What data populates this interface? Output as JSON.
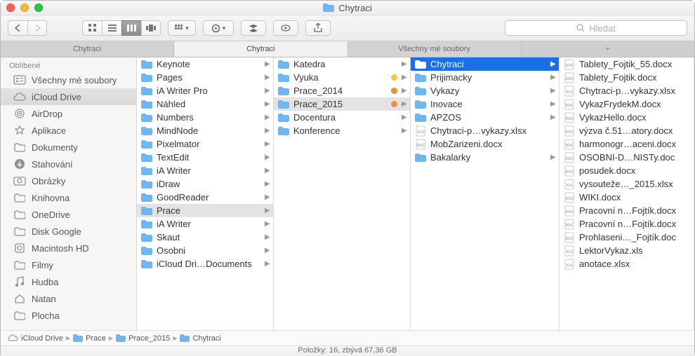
{
  "window": {
    "title": "Chytraci"
  },
  "search": {
    "placeholder": "Hledat"
  },
  "tabs": [
    {
      "label": "Chytraci",
      "active": false
    },
    {
      "label": "Chytraci",
      "active": true
    },
    {
      "label": "Všechny mé soubory",
      "active": false
    }
  ],
  "sidebar": {
    "section": "Oblíbené",
    "items": [
      {
        "label": "Všechny mé soubory",
        "icon": "all-files"
      },
      {
        "label": "iCloud Drive",
        "icon": "icloud",
        "selected": true
      },
      {
        "label": "AirDrop",
        "icon": "airdrop"
      },
      {
        "label": "Aplikace",
        "icon": "apps"
      },
      {
        "label": "Dokumenty",
        "icon": "folder"
      },
      {
        "label": "Stahování",
        "icon": "download"
      },
      {
        "label": "Obrázky",
        "icon": "pictures"
      },
      {
        "label": "Knihovna",
        "icon": "folder"
      },
      {
        "label": "OneDrive",
        "icon": "folder"
      },
      {
        "label": "Disk Google",
        "icon": "folder"
      },
      {
        "label": "Macintosh HD",
        "icon": "disk"
      },
      {
        "label": "Filmy",
        "icon": "folder"
      },
      {
        "label": "Hudba",
        "icon": "music"
      },
      {
        "label": "Natan",
        "icon": "home"
      },
      {
        "label": "Plocha",
        "icon": "folder"
      }
    ]
  },
  "columns": [
    [
      {
        "label": "Keynote",
        "type": "folder",
        "expandable": true
      },
      {
        "label": "Pages",
        "type": "folder",
        "expandable": true
      },
      {
        "label": "iA Writer Pro",
        "type": "folder",
        "expandable": true
      },
      {
        "label": "Náhled",
        "type": "folder",
        "expandable": true
      },
      {
        "label": "Numbers",
        "type": "folder",
        "expandable": true
      },
      {
        "label": "MindNode",
        "type": "folder",
        "expandable": true
      },
      {
        "label": "Pixelmator",
        "type": "folder",
        "expandable": true
      },
      {
        "label": "TextEdit",
        "type": "folder",
        "expandable": true
      },
      {
        "label": "iA Writer",
        "type": "folder",
        "expandable": true
      },
      {
        "label": "iDraw",
        "type": "folder",
        "expandable": true
      },
      {
        "label": "GoodReader",
        "type": "folder",
        "expandable": true
      },
      {
        "label": "Prace",
        "type": "folder",
        "expandable": true,
        "selected": true
      },
      {
        "label": "iA Writer",
        "type": "folder",
        "expandable": true
      },
      {
        "label": "Skaut",
        "type": "folder",
        "expandable": true
      },
      {
        "label": "Osobni",
        "type": "folder",
        "expandable": true
      },
      {
        "label": "iCloud Dri…Documents",
        "type": "folder",
        "expandable": true
      }
    ],
    [
      {
        "label": "Katedra",
        "type": "folder",
        "expandable": true
      },
      {
        "label": "Vyuka",
        "type": "folder",
        "expandable": true,
        "tag": "#f7c645"
      },
      {
        "label": "Prace_2014",
        "type": "folder",
        "expandable": true,
        "tag": "#f58b32"
      },
      {
        "label": "Prace_2015",
        "type": "folder",
        "expandable": true,
        "selected": true,
        "tag": "#f58b32"
      },
      {
        "label": "Docentura",
        "type": "folder",
        "expandable": true
      },
      {
        "label": "Konference",
        "type": "folder",
        "expandable": true
      }
    ],
    [
      {
        "label": "Chytraci",
        "type": "folder",
        "expandable": true,
        "highlighted": true
      },
      {
        "label": "Prijimacky",
        "type": "folder",
        "expandable": true
      },
      {
        "label": "Vykazy",
        "type": "folder",
        "expandable": true
      },
      {
        "label": "Inovace",
        "type": "folder",
        "expandable": true
      },
      {
        "label": "APZOS",
        "type": "folder",
        "expandable": true
      },
      {
        "label": "Chytraci-p…vykazy.xlsx",
        "type": "xls"
      },
      {
        "label": "MobZarizeni.docx",
        "type": "doc"
      },
      {
        "label": "Bakalarky",
        "type": "folder",
        "expandable": true
      }
    ],
    [
      {
        "label": "Tablety_Fojtik_55.docx",
        "type": "doc"
      },
      {
        "label": "Tablety_Fojtik.docx",
        "type": "doc"
      },
      {
        "label": "Chytraci-p…vykazy.xlsx",
        "type": "xls"
      },
      {
        "label": "VykazFrydekM.docx",
        "type": "doc"
      },
      {
        "label": "VykazHello.docx",
        "type": "doc"
      },
      {
        "label": "výzva č.51…atory.docx",
        "type": "doc"
      },
      {
        "label": "harmonogr…aceni.docx",
        "type": "doc"
      },
      {
        "label": "OSOBNI-D…NISTy.doc",
        "type": "doc"
      },
      {
        "label": "posudek.docx",
        "type": "doc"
      },
      {
        "label": "vysouteže…_2015.xlsx",
        "type": "xls"
      },
      {
        "label": "WIKI.docx",
        "type": "doc"
      },
      {
        "label": "Pracovní n…Fojtík.docx",
        "type": "doc"
      },
      {
        "label": "Pracovní n…Fojtík.docx",
        "type": "doc"
      },
      {
        "label": "Prohlaseni…_Fojtík.doc",
        "type": "doc"
      },
      {
        "label": "LektorVykaz.xls",
        "type": "xls"
      },
      {
        "label": "anotace.xlsx",
        "type": "xls"
      }
    ]
  ],
  "path": [
    {
      "label": "iCloud Drive",
      "icon": "icloud"
    },
    {
      "label": "Prace",
      "icon": "folder"
    },
    {
      "label": "Prace_2015",
      "icon": "folder"
    },
    {
      "label": "Chytraci",
      "icon": "folder"
    }
  ],
  "status": "Položky: 16, zbývá 67,36 GB"
}
